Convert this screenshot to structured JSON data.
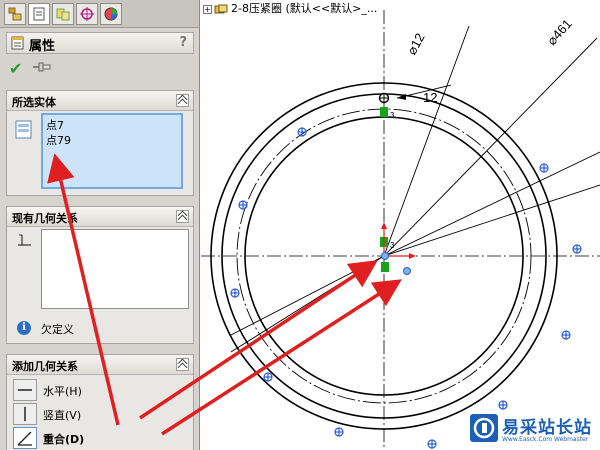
{
  "feature_tree": {
    "node_label": "2-8压紧圈 (默认<<默认>_...",
    "node_icon": "part-icon"
  },
  "property_manager": {
    "tabs": [
      {
        "name": "feature-manager-tab",
        "icon": "feature-tree-icon"
      },
      {
        "name": "property-manager-tab",
        "icon": "property-icon"
      },
      {
        "name": "configuration-manager-tab",
        "icon": "config-icon"
      },
      {
        "name": "dim-xpert-tab",
        "icon": "crosshair-icon"
      },
      {
        "name": "display-manager-tab",
        "icon": "appearance-ball-icon"
      }
    ],
    "title": "属性",
    "help": "?",
    "ok_icon": "check-icon",
    "pin_icon": "pushpin-icon",
    "selected_entities": {
      "heading": "所选实体",
      "items": [
        "点7",
        "点79"
      ]
    },
    "existing_relations": {
      "heading": "现有几何关系",
      "items": [],
      "status": "欠定义",
      "status_icon": "info-icon"
    },
    "add_relations": {
      "heading": "添加几何关系",
      "items": [
        {
          "label": "水平(H)",
          "icon": "horizontal-icon",
          "selected": false
        },
        {
          "label": "竖直(V)",
          "icon": "vertical-icon",
          "selected": false
        },
        {
          "label": "重合(D)",
          "icon": "coincident-icon",
          "selected": true
        }
      ]
    }
  },
  "sketch": {
    "dimensions": [
      "⌀12",
      "⌀461",
      "12"
    ],
    "relation_glyph": "3",
    "colors": {
      "geometry": "#000000",
      "points": "#2a5fd4",
      "relation": "#1aa21a",
      "arrow": "#e02020"
    }
  },
  "watermark": {
    "text": "易采站长站",
    "url": "Www.Easck.Com Webmaster"
  }
}
